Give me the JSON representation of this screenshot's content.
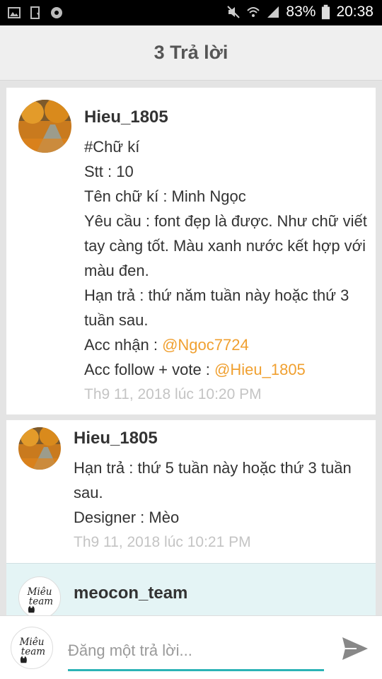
{
  "status_bar": {
    "battery_percent": "83%",
    "time": "20:38"
  },
  "header": {
    "title": "3 Trả lời"
  },
  "comments": [
    {
      "username": "Hieu_1805",
      "lines": [
        "#Chữ kí",
        "Stt : 10",
        "Tên chữ kí : Minh Ngọc",
        "Yêu cầu : font đẹp là được. Như chữ viết tay càng tốt. Màu xanh nước kết hợp với màu đen.",
        "Hạn trả : thứ năm tuần này hoặc thứ 3 tuần sau."
      ],
      "acc_receive_label": "Acc nhận : ",
      "acc_receive_mention": "@Ngoc7724",
      "acc_follow_label": "Acc follow + vote : ",
      "acc_follow_mention": "@Hieu_1805",
      "timestamp": "Th9 11, 2018 lúc 10:20 PM"
    },
    {
      "username": "Hieu_1805",
      "lines": [
        "Hạn trả : thứ 5 tuần này hoặc thứ 3 tuần sau.",
        "Designer : Mèo"
      ],
      "timestamp": "Th9 11, 2018 lúc 10:21 PM"
    },
    {
      "username": "meocon_team",
      "avatar_text": [
        "Miêu",
        "team"
      ]
    }
  ],
  "composer": {
    "placeholder": "Đăng một trả lời...",
    "avatar_text": [
      "Miêu",
      "team"
    ]
  },
  "colors": {
    "mention": "#f0a030",
    "accent": "#2bb3b6",
    "highlight_bg": "#e4f4f5"
  }
}
